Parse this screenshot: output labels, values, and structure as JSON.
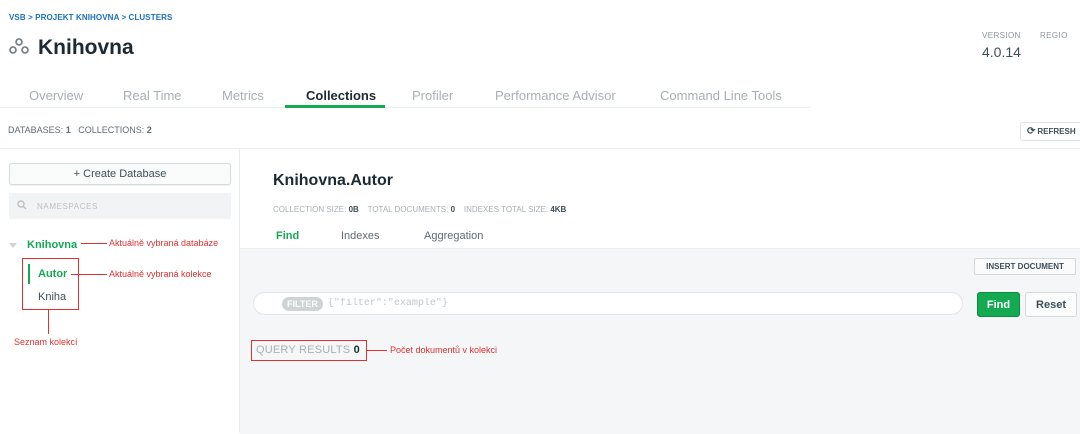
{
  "breadcrumb": "VSB > PROJEKT KNIHOVNA > CLUSTERS",
  "header": {
    "title": "Knihovna",
    "version_label": "VERSION",
    "version_value": "4.0.14",
    "region_label": "REGIO"
  },
  "tabs": [
    {
      "label": "Overview"
    },
    {
      "label": "Real Time"
    },
    {
      "label": "Metrics"
    },
    {
      "label": "Collections"
    },
    {
      "label": "Profiler"
    },
    {
      "label": "Performance Advisor"
    },
    {
      "label": "Command Line Tools"
    }
  ],
  "stats": {
    "databases_label": "DATABASES:",
    "databases_value": "1",
    "collections_label": "COLLECTIONS:",
    "collections_value": "2"
  },
  "refresh_label": "REFRESH",
  "sidebar": {
    "create_db_label": "+ Create Database",
    "namespace_placeholder": "NAMESPACES",
    "database": "Knihovna",
    "collections": [
      "Autor",
      "Kniha"
    ]
  },
  "collection": {
    "title": "Knihovna.Autor",
    "size_label": "COLLECTION SIZE:",
    "size_value": "0B",
    "docs_label": "TOTAL DOCUMENTS:",
    "docs_value": "0",
    "indexes_label": "INDEXES TOTAL SIZE:",
    "indexes_value": "4KB",
    "subtabs": [
      "Find",
      "Indexes",
      "Aggregation"
    ]
  },
  "find": {
    "insert_label": "INSERT DOCUMENT",
    "filter_pill": "FILTER",
    "filter_placeholder": "{\"filter\":\"example\"}",
    "find_label": "Find",
    "reset_label": "Reset",
    "query_results_label": "QUERY RESULTS",
    "query_results_value": "0"
  },
  "annotations": {
    "database": "Aktuálně vybraná databáze",
    "collection": "Aktuálně vybraná kolekce",
    "collection_list": "Seznam kolekcí",
    "doc_count": "Počet dokumentů v kolekci"
  },
  "colors": {
    "accent_green": "#13aa52",
    "link_blue": "#1a6fbf",
    "annotation_red": "#e03131"
  }
}
